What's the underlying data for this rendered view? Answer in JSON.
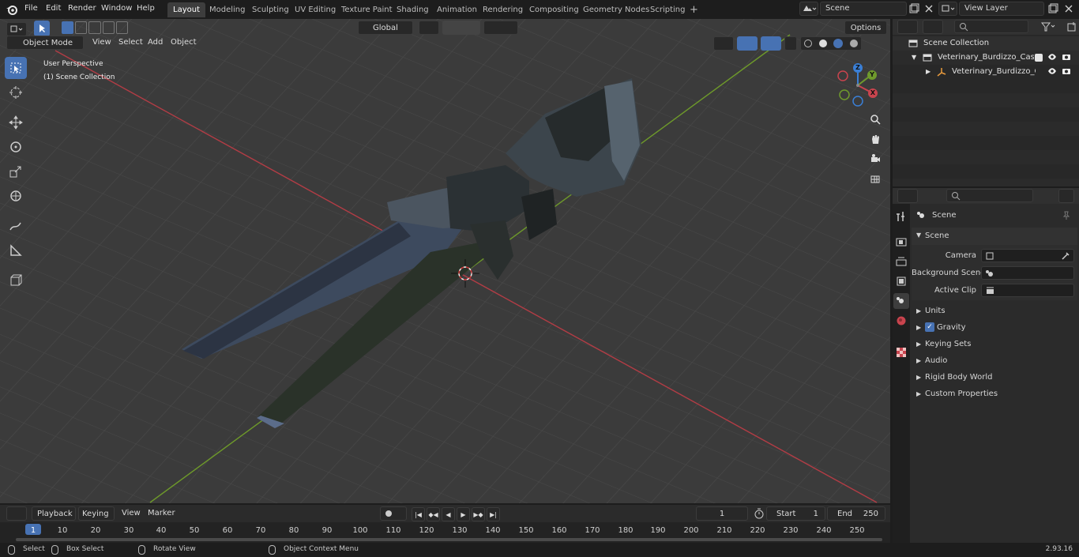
{
  "topbar": {
    "menus": [
      "File",
      "Edit",
      "Render",
      "Window",
      "Help"
    ],
    "workspaces": [
      "Layout",
      "Modeling",
      "Sculpting",
      "UV Editing",
      "Texture Paint",
      "Shading",
      "Animation",
      "Rendering",
      "Compositing",
      "Geometry Nodes",
      "Scripting"
    ],
    "active_workspace": "Layout",
    "add_tab": "+",
    "scene_name": "Scene",
    "view_layer": "View Layer"
  },
  "viewport": {
    "mode": "Object Mode",
    "menus": [
      "View",
      "Select",
      "Add",
      "Object"
    ],
    "transform_orientation": "Global",
    "options_label": "Options",
    "overlay_line1": "User Perspective",
    "overlay_line2": "(1) Scene Collection",
    "gizmo_axes": {
      "x": "X",
      "y": "Y",
      "z": "Z"
    }
  },
  "outliner": {
    "collection": "Scene Collection",
    "items": [
      {
        "name": "Veterinary_Burdizzo_Castratio"
      },
      {
        "name": "Veterinary_Burdizzo_Cas"
      }
    ]
  },
  "properties": {
    "context": "Scene",
    "panel_title": "Scene",
    "fields": [
      {
        "label": "Camera"
      },
      {
        "label": "Background Scene"
      },
      {
        "label": "Active Clip"
      }
    ],
    "sections": [
      {
        "name": "Units",
        "checkbox": false
      },
      {
        "name": "Gravity",
        "checkbox": true
      },
      {
        "name": "Keying Sets",
        "checkbox": false
      },
      {
        "name": "Audio",
        "checkbox": false
      },
      {
        "name": "Rigid Body World",
        "checkbox": false
      },
      {
        "name": "Custom Properties",
        "checkbox": false
      }
    ]
  },
  "timeline": {
    "menus": [
      "Playback",
      "Keying",
      "View",
      "Marker"
    ],
    "current_frame": "1",
    "start_label": "Start",
    "start": "1",
    "end_label": "End",
    "end": "250",
    "ruler": [
      "1",
      "10",
      "20",
      "30",
      "40",
      "50",
      "60",
      "70",
      "80",
      "90",
      "100",
      "110",
      "120",
      "130",
      "140",
      "150",
      "160",
      "170",
      "180",
      "190",
      "200",
      "210",
      "220",
      "230",
      "240",
      "250"
    ]
  },
  "statusbar": {
    "select": "Select",
    "box_select": "Box Select",
    "rotate_view": "Rotate View",
    "context_menu": "Object Context Menu",
    "version": "2.93.16"
  },
  "colors": {
    "accent": "#4772b3",
    "x_axis": "#c9444e",
    "y_axis": "#6f9a2c",
    "z_axis": "#3a7fd6",
    "viewport_bg": "#3b3b3b"
  }
}
